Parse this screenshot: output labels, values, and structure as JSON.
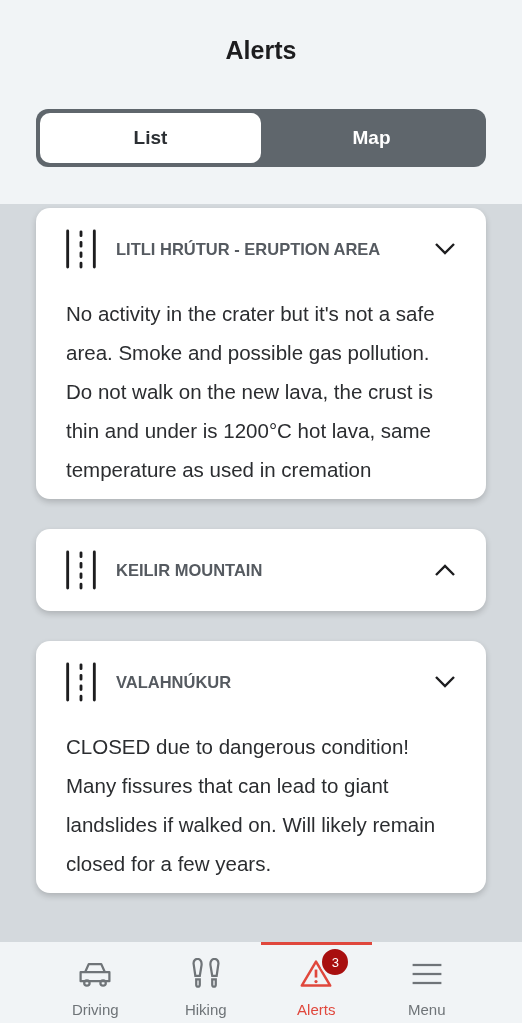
{
  "header": {
    "title": "Alerts"
  },
  "tabs": [
    {
      "label": "List",
      "selected": true
    },
    {
      "label": "Map",
      "selected": false
    }
  ],
  "alerts": [
    {
      "title": "LITLI HRÚTUR - ERUPTION AREA",
      "expanded": true,
      "text": "No activity in the crater but it's not a safe area. Smoke and possible gas pollution. Do not walk on the new lava, the crust is thin and under is 1200°C hot lava, same temperature as used in cremation"
    },
    {
      "title": "KEILIR MOUNTAIN",
      "expanded": false
    },
    {
      "title": "VALAHNÚKUR",
      "expanded": true,
      "text": "CLOSED due to dangerous condition! Many fissures that can lead to giant landslides if walked on. Will likely remain closed for a few years."
    }
  ],
  "nav": [
    {
      "label": "Driving",
      "selected": false
    },
    {
      "label": "Hiking",
      "selected": false
    },
    {
      "label": "Alerts",
      "selected": true,
      "badge": "3"
    },
    {
      "label": "Menu",
      "selected": false
    }
  ]
}
